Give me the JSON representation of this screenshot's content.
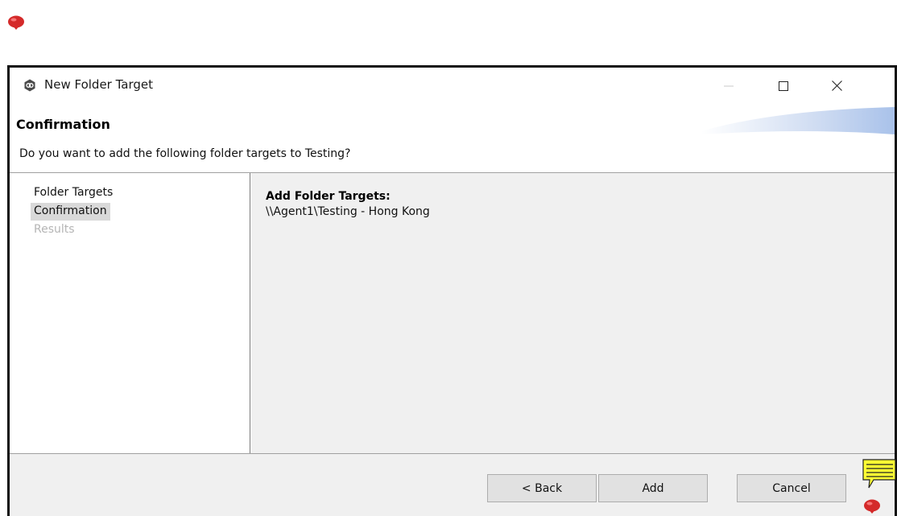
{
  "window": {
    "title": "New Folder Target",
    "controls": {
      "minimize": "—",
      "maximize": "☐",
      "close": "✕"
    }
  },
  "banner": {
    "title": "Confirmation",
    "description": "Do you want to add the following folder targets to Testing?"
  },
  "steps": [
    {
      "label": "Folder Targets",
      "state": "completed"
    },
    {
      "label": "Confirmation",
      "state": "current"
    },
    {
      "label": "Results",
      "state": "disabled"
    }
  ],
  "content": {
    "heading": "Add Folder Targets:",
    "items": [
      "\\\\Agent1\\Testing - Hong Kong"
    ]
  },
  "buttons": {
    "back": "< Back",
    "add": "Add",
    "cancel": "Cancel"
  },
  "colors": {
    "pin": "#d42a2a",
    "note": "#ffff33",
    "selected_step_bg": "#d9d9d9",
    "content_bg": "#f0f0f0",
    "disabled_text": "#b5b5b5"
  },
  "icons": {
    "pins": "map-pin-icon",
    "note": "note-icon",
    "app": "app-logo-icon"
  }
}
